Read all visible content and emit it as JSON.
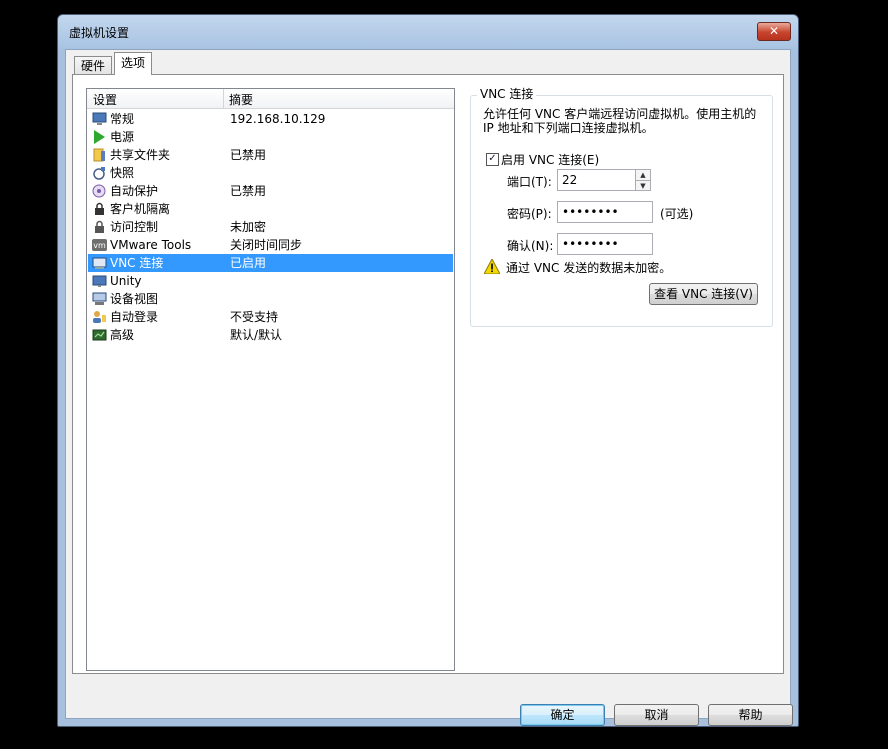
{
  "window": {
    "title": "虚拟机设置",
    "close_label": "✕"
  },
  "tabs": [
    {
      "label": "硬件"
    },
    {
      "label": "选项"
    }
  ],
  "list": {
    "header_setting": "设置",
    "header_summary": "摘要",
    "rows": [
      {
        "name": "常规",
        "summary": "192.168.10.129",
        "icon": "monitor-icon"
      },
      {
        "name": "电源",
        "summary": "",
        "icon": "play-icon"
      },
      {
        "name": "共享文件夹",
        "summary": "已禁用",
        "icon": "folder-icon"
      },
      {
        "name": "快照",
        "summary": "",
        "icon": "snapshot-icon"
      },
      {
        "name": "自动保护",
        "summary": "已禁用",
        "icon": "autoprotect-icon"
      },
      {
        "name": "客户机隔离",
        "summary": "",
        "icon": "lock-icon"
      },
      {
        "name": "访问控制",
        "summary": "未加密",
        "icon": "lock-icon"
      },
      {
        "name": "VMware Tools",
        "summary": "关闭时间同步",
        "icon": "vm-icon"
      },
      {
        "name": "VNC 连接",
        "summary": "已启用",
        "icon": "vnc-icon",
        "selected": true
      },
      {
        "name": "Unity",
        "summary": "",
        "icon": "unity-icon"
      },
      {
        "name": "设备视图",
        "summary": "",
        "icon": "device-view-icon"
      },
      {
        "name": "自动登录",
        "summary": "不受支持",
        "icon": "user-icon"
      },
      {
        "name": "高级",
        "summary": "默认/默认",
        "icon": "advanced-icon"
      }
    ]
  },
  "vnc": {
    "group_title": "VNC 连接",
    "description": "允许任何 VNC 客户端远程访问虚拟机。使用主机的 IP 地址和下列端口连接虚拟机。",
    "enable_label": "启用 VNC 连接(E)",
    "enable_checked": true,
    "port_label": "端口(T):",
    "port_value": "22",
    "password_label": "密码(P):",
    "password_value": "••••••••",
    "optional_label": "(可选)",
    "confirm_label": "确认(N):",
    "confirm_value": "••••••••",
    "warning_text": "通过 VNC 发送的数据未加密。",
    "view_button": "查看 VNC 连接(V)"
  },
  "buttons": {
    "ok": "确定",
    "cancel": "取消",
    "help": "帮助"
  },
  "colors": {
    "selection": "#3399ff",
    "accent_title": "#c3d7ee"
  }
}
